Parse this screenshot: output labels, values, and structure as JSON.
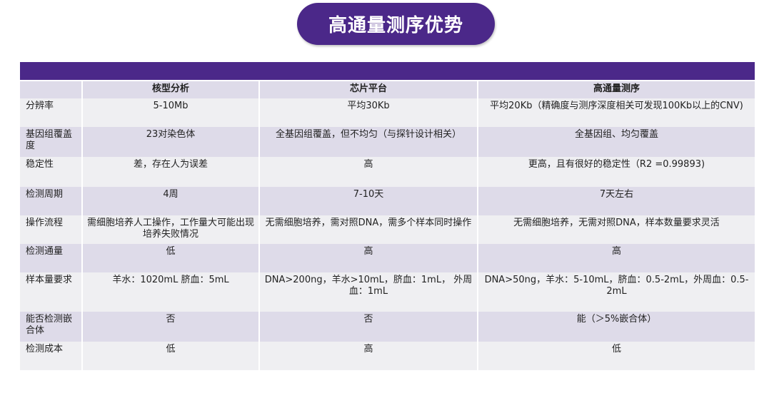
{
  "title": "高通量测序优势",
  "table": {
    "headers": [
      "",
      "核型分析",
      "芯片平台",
      "高通量测序"
    ],
    "rows": [
      {
        "label": "分辨率",
        "cells": [
          "5-10Mb",
          "平均30Kb",
          "平均20Kb（精确度与测序深度相关可发现100Kb以上的CNV)"
        ]
      },
      {
        "label": "基因组覆盖度",
        "cells": [
          "23对染色体",
          "全基因组覆盖，但不均匀（与探针设计相关）",
          "全基因组、均匀覆盖"
        ]
      },
      {
        "label": "稳定性",
        "cells": [
          "差，存在人为误差",
          "高",
          "更高，且有很好的稳定性（R2 =0.99893)"
        ]
      },
      {
        "label": "检测周期",
        "cells": [
          "4周",
          "7-10天",
          "7天左右"
        ]
      },
      {
        "label": "操作流程",
        "cells": [
          "需细胞培养人工操作，工作量大可能出现培养失败情况",
          "无需细胞培养，需对照DNA，需多个样本同时操作",
          "无需细胞培养，无需对照DNA，样本数量要求灵活"
        ]
      },
      {
        "label": "检测通量",
        "cells": [
          "低",
          "高",
          "高"
        ]
      },
      {
        "label": "样本量要求",
        "cells": [
          "羊水：1020mL 脐血：5mL",
          "DNA>200ng，羊水>10mL，脐血：1mL， 外周血：1mL",
          "DNA>50ng，羊水：5-10mL，脐血：0.5-2mL，外周血：0.5-2mL"
        ]
      },
      {
        "label": "能否检测嵌合体",
        "cells": [
          "否",
          "否",
          "能（＞5%嵌合体）"
        ]
      },
      {
        "label": "检测成本",
        "cells": [
          "低",
          "高",
          "低"
        ]
      }
    ]
  },
  "colors": {
    "accent": "#4b2889",
    "row_light": "#efeff2",
    "row_dark": "#dedbe9"
  }
}
